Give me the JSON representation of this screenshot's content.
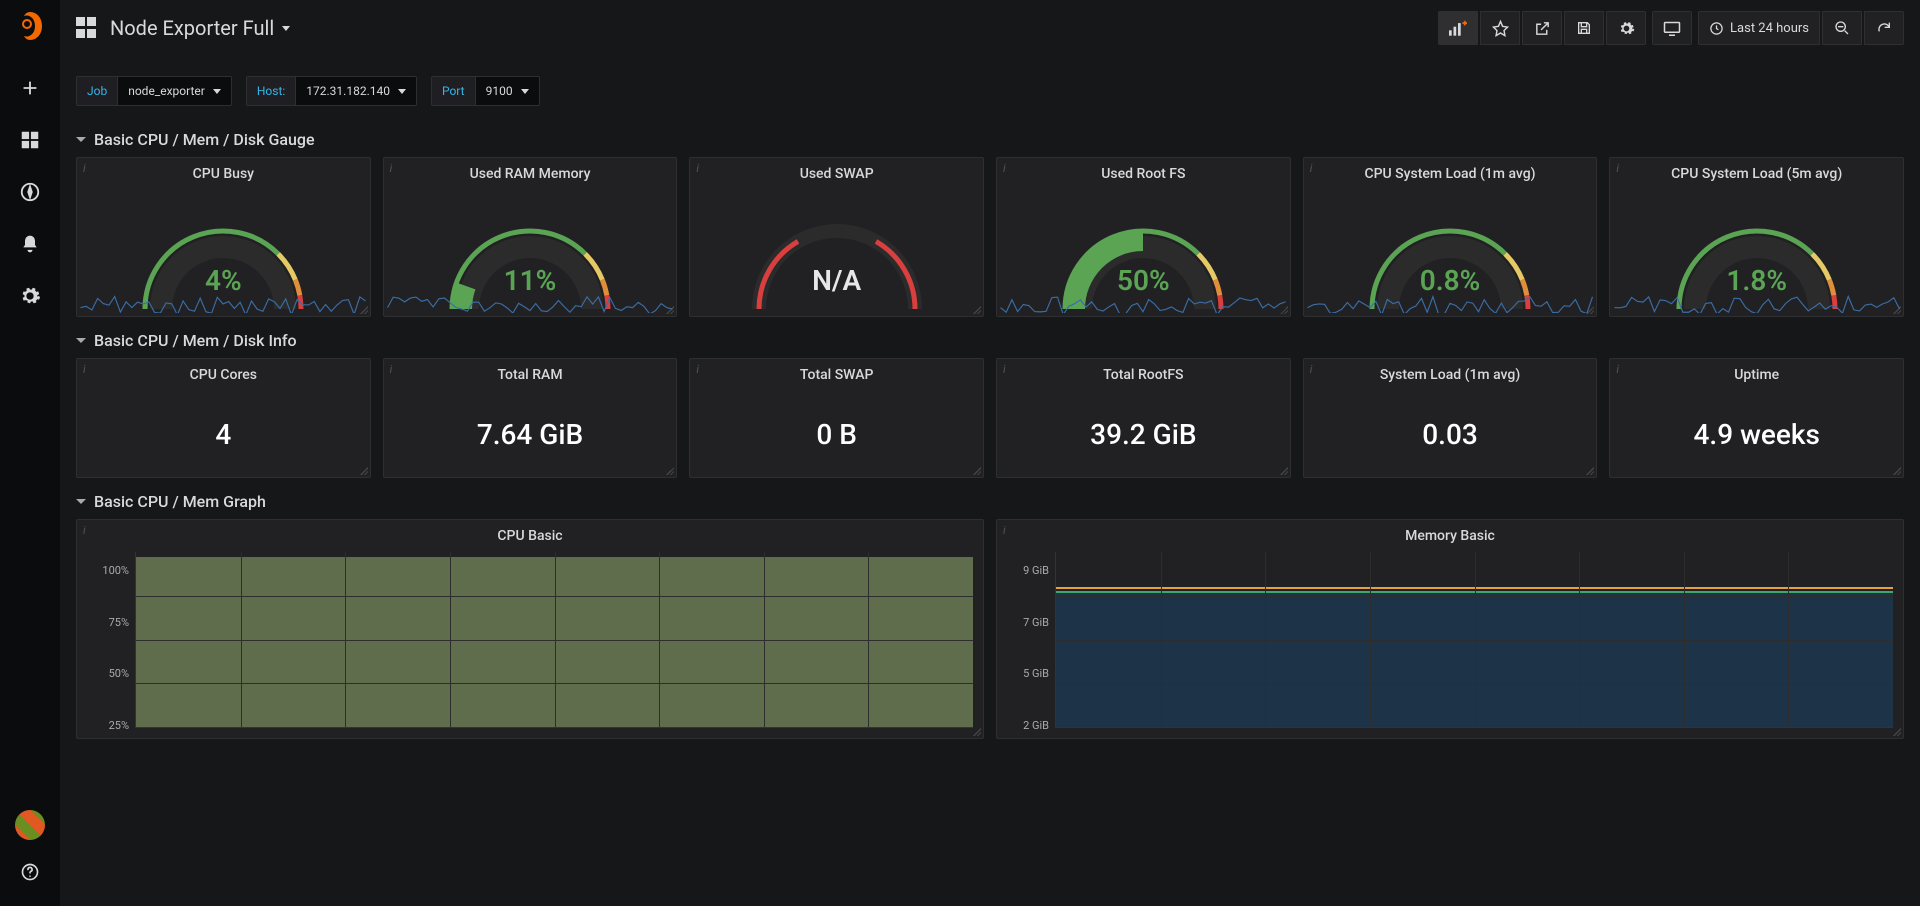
{
  "header": {
    "title": "Node Exporter Full"
  },
  "timepicker": {
    "label": "Last 24 hours"
  },
  "vars": {
    "job_label": "Job",
    "job_value": "node_exporter",
    "host_label": "Host:",
    "host_value": "172.31.182.140",
    "port_label": "Port",
    "port_value": "9100"
  },
  "rows": {
    "gauges": "Basic CPU / Mem / Disk Gauge",
    "info": "Basic CPU / Mem / Disk Info",
    "graphs": "Basic CPU / Mem Graph"
  },
  "gauge_panels": [
    {
      "title": "CPU Busy",
      "value": "4%",
      "color": "green",
      "frac": 0.04,
      "na": false,
      "fill": false
    },
    {
      "title": "Used RAM Memory",
      "value": "11%",
      "color": "green",
      "frac": 0.11,
      "na": false,
      "fill": true
    },
    {
      "title": "Used SWAP",
      "value": "N/A",
      "color": "na",
      "frac": 0,
      "na": true,
      "fill": false
    },
    {
      "title": "Used Root FS",
      "value": "50%",
      "color": "green",
      "frac": 0.5,
      "na": false,
      "fill": true
    },
    {
      "title": "CPU System Load (1m avg)",
      "value": "0.8%",
      "color": "green",
      "frac": 0.008,
      "na": false,
      "fill": false
    },
    {
      "title": "CPU System Load (5m avg)",
      "value": "1.8%",
      "color": "green",
      "frac": 0.018,
      "na": false,
      "fill": false
    }
  ],
  "info_panels": [
    {
      "title": "CPU Cores",
      "value": "4"
    },
    {
      "title": "Total RAM",
      "value": "7.64 GiB"
    },
    {
      "title": "Total SWAP",
      "value": "0 B"
    },
    {
      "title": "Total RootFS",
      "value": "39.2 GiB"
    },
    {
      "title": "System Load (1m avg)",
      "value": "0.03"
    },
    {
      "title": "Uptime",
      "value": "4.9 weeks"
    }
  ],
  "cpu_graph": {
    "title": "CPU Basic",
    "ylabels": [
      "100%",
      "75%",
      "50%",
      "25%"
    ]
  },
  "mem_graph": {
    "title": "Memory Basic",
    "ylabels": [
      "9 GiB",
      "7 GiB",
      "5 GiB",
      "2 GiB"
    ]
  },
  "chart_data": [
    {
      "type": "line",
      "title": "CPU Busy",
      "ylim": [
        0,
        100
      ],
      "values": [
        4
      ]
    },
    {
      "type": "line",
      "title": "Used RAM Memory",
      "ylim": [
        0,
        100
      ],
      "values": [
        11
      ]
    },
    {
      "type": "line",
      "title": "Used Root FS",
      "ylim": [
        0,
        100
      ],
      "values": [
        50
      ]
    },
    {
      "type": "area",
      "title": "CPU Basic",
      "ylabel": "%",
      "ylim": [
        0,
        100
      ],
      "note": "stacked area near 100% across 24h"
    },
    {
      "type": "area",
      "title": "Memory Basic",
      "ylabel": "GiB",
      "ylim": [
        0,
        9
      ],
      "note": "flat area around 7.4 GiB across 24h"
    }
  ]
}
